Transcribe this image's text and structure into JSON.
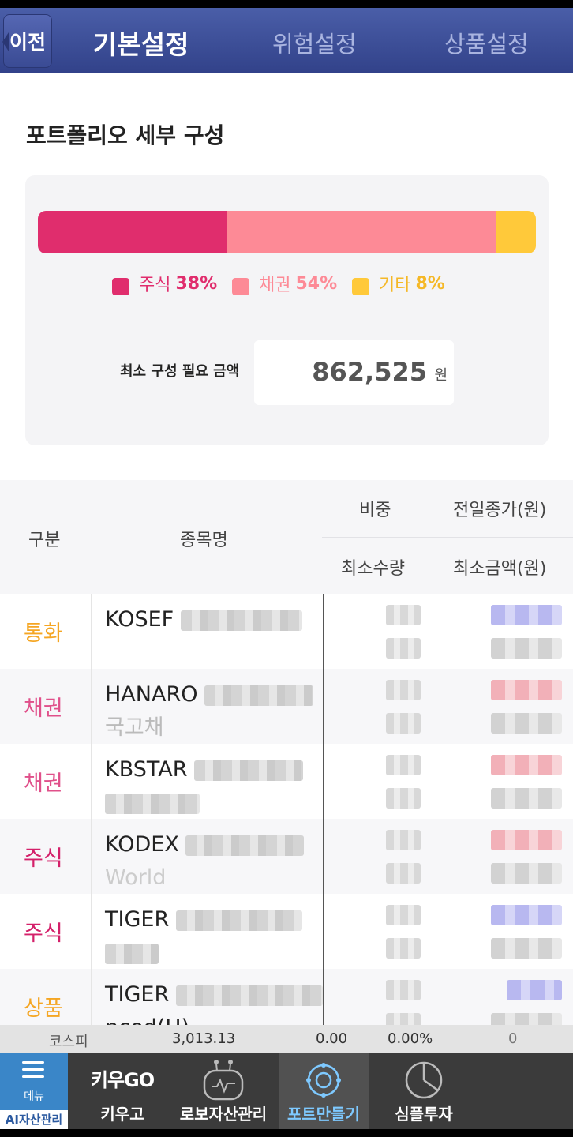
{
  "header": {
    "back_label": "이전",
    "tabs": [
      {
        "label": "기본설정",
        "active": true
      },
      {
        "label": "위험설정",
        "active": false
      },
      {
        "label": "상품설정",
        "active": false
      }
    ]
  },
  "portfolio": {
    "title": "포트폴리오 세부 구성",
    "allocation": [
      {
        "label": "주식",
        "percent_text": "38%",
        "percent": 38,
        "color": "#e02d6d"
      },
      {
        "label": "채권",
        "percent_text": "54%",
        "percent": 54,
        "color": "#fd8a96"
      },
      {
        "label": "기타",
        "percent_text": "8%",
        "percent": 8,
        "color": "#ffc93a"
      }
    ],
    "min_amount_label": "최소 구성 필요 금액",
    "min_amount_value": "862,525",
    "min_amount_unit": "원"
  },
  "table": {
    "headers": {
      "category": "구분",
      "name": "종목명",
      "weight": "비중",
      "prev_close": "전일종가(원)",
      "min_qty": "최소수량",
      "min_amount": "최소금액(원)"
    },
    "rows": [
      {
        "category": "통화",
        "name_line1": "KOSEF",
        "name_line2": ""
      },
      {
        "category": "채권",
        "name_line1": "HANARO",
        "name_line2": "국고채"
      },
      {
        "category": "채권",
        "name_line1": "KBSTAR",
        "name_line2": ""
      },
      {
        "category": "주식",
        "name_line1": "KODEX",
        "name_line2": "World"
      },
      {
        "category": "주식",
        "name_line1": "TIGER",
        "name_line2": ""
      },
      {
        "category": "상품",
        "name_line1": "TIGER",
        "name_line2": "nced(H)"
      }
    ]
  },
  "ticker": {
    "name": "코스피",
    "index": "3,013.13",
    "change": "0.00",
    "rate": "0.00%",
    "volume": "0"
  },
  "bottom_nav": {
    "menu_label": "메뉴",
    "ai_label": "AI자산관리",
    "items": [
      {
        "label": "키우고",
        "logo": "키우GO",
        "icon": "kiwoogo-logo-icon"
      },
      {
        "label": "로보자산관리",
        "icon": "robot-icon"
      },
      {
        "label": "포트만들기",
        "icon": "target-icon",
        "active": true
      },
      {
        "label": "심플투자",
        "icon": "pie-chart-icon"
      }
    ]
  }
}
